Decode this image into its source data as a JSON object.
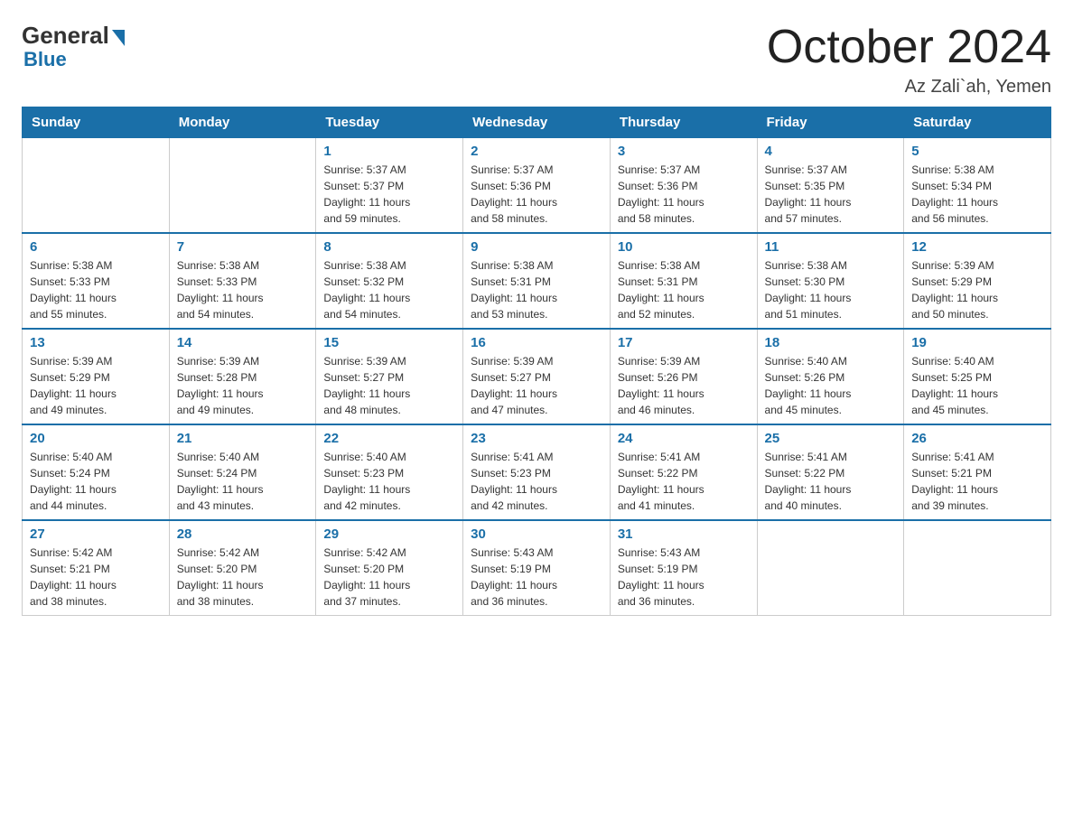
{
  "logo": {
    "general": "General",
    "blue": "Blue",
    "tagline": "Blue"
  },
  "title": "October 2024",
  "location": "Az Zali`ah, Yemen",
  "days_of_week": [
    "Sunday",
    "Monday",
    "Tuesday",
    "Wednesday",
    "Thursday",
    "Friday",
    "Saturday"
  ],
  "weeks": [
    [
      {
        "day": "",
        "info": ""
      },
      {
        "day": "",
        "info": ""
      },
      {
        "day": "1",
        "info": "Sunrise: 5:37 AM\nSunset: 5:37 PM\nDaylight: 11 hours\nand 59 minutes."
      },
      {
        "day": "2",
        "info": "Sunrise: 5:37 AM\nSunset: 5:36 PM\nDaylight: 11 hours\nand 58 minutes."
      },
      {
        "day": "3",
        "info": "Sunrise: 5:37 AM\nSunset: 5:36 PM\nDaylight: 11 hours\nand 58 minutes."
      },
      {
        "day": "4",
        "info": "Sunrise: 5:37 AM\nSunset: 5:35 PM\nDaylight: 11 hours\nand 57 minutes."
      },
      {
        "day": "5",
        "info": "Sunrise: 5:38 AM\nSunset: 5:34 PM\nDaylight: 11 hours\nand 56 minutes."
      }
    ],
    [
      {
        "day": "6",
        "info": "Sunrise: 5:38 AM\nSunset: 5:33 PM\nDaylight: 11 hours\nand 55 minutes."
      },
      {
        "day": "7",
        "info": "Sunrise: 5:38 AM\nSunset: 5:33 PM\nDaylight: 11 hours\nand 54 minutes."
      },
      {
        "day": "8",
        "info": "Sunrise: 5:38 AM\nSunset: 5:32 PM\nDaylight: 11 hours\nand 54 minutes."
      },
      {
        "day": "9",
        "info": "Sunrise: 5:38 AM\nSunset: 5:31 PM\nDaylight: 11 hours\nand 53 minutes."
      },
      {
        "day": "10",
        "info": "Sunrise: 5:38 AM\nSunset: 5:31 PM\nDaylight: 11 hours\nand 52 minutes."
      },
      {
        "day": "11",
        "info": "Sunrise: 5:38 AM\nSunset: 5:30 PM\nDaylight: 11 hours\nand 51 minutes."
      },
      {
        "day": "12",
        "info": "Sunrise: 5:39 AM\nSunset: 5:29 PM\nDaylight: 11 hours\nand 50 minutes."
      }
    ],
    [
      {
        "day": "13",
        "info": "Sunrise: 5:39 AM\nSunset: 5:29 PM\nDaylight: 11 hours\nand 49 minutes."
      },
      {
        "day": "14",
        "info": "Sunrise: 5:39 AM\nSunset: 5:28 PM\nDaylight: 11 hours\nand 49 minutes."
      },
      {
        "day": "15",
        "info": "Sunrise: 5:39 AM\nSunset: 5:27 PM\nDaylight: 11 hours\nand 48 minutes."
      },
      {
        "day": "16",
        "info": "Sunrise: 5:39 AM\nSunset: 5:27 PM\nDaylight: 11 hours\nand 47 minutes."
      },
      {
        "day": "17",
        "info": "Sunrise: 5:39 AM\nSunset: 5:26 PM\nDaylight: 11 hours\nand 46 minutes."
      },
      {
        "day": "18",
        "info": "Sunrise: 5:40 AM\nSunset: 5:26 PM\nDaylight: 11 hours\nand 45 minutes."
      },
      {
        "day": "19",
        "info": "Sunrise: 5:40 AM\nSunset: 5:25 PM\nDaylight: 11 hours\nand 45 minutes."
      }
    ],
    [
      {
        "day": "20",
        "info": "Sunrise: 5:40 AM\nSunset: 5:24 PM\nDaylight: 11 hours\nand 44 minutes."
      },
      {
        "day": "21",
        "info": "Sunrise: 5:40 AM\nSunset: 5:24 PM\nDaylight: 11 hours\nand 43 minutes."
      },
      {
        "day": "22",
        "info": "Sunrise: 5:40 AM\nSunset: 5:23 PM\nDaylight: 11 hours\nand 42 minutes."
      },
      {
        "day": "23",
        "info": "Sunrise: 5:41 AM\nSunset: 5:23 PM\nDaylight: 11 hours\nand 42 minutes."
      },
      {
        "day": "24",
        "info": "Sunrise: 5:41 AM\nSunset: 5:22 PM\nDaylight: 11 hours\nand 41 minutes."
      },
      {
        "day": "25",
        "info": "Sunrise: 5:41 AM\nSunset: 5:22 PM\nDaylight: 11 hours\nand 40 minutes."
      },
      {
        "day": "26",
        "info": "Sunrise: 5:41 AM\nSunset: 5:21 PM\nDaylight: 11 hours\nand 39 minutes."
      }
    ],
    [
      {
        "day": "27",
        "info": "Sunrise: 5:42 AM\nSunset: 5:21 PM\nDaylight: 11 hours\nand 38 minutes."
      },
      {
        "day": "28",
        "info": "Sunrise: 5:42 AM\nSunset: 5:20 PM\nDaylight: 11 hours\nand 38 minutes."
      },
      {
        "day": "29",
        "info": "Sunrise: 5:42 AM\nSunset: 5:20 PM\nDaylight: 11 hours\nand 37 minutes."
      },
      {
        "day": "30",
        "info": "Sunrise: 5:43 AM\nSunset: 5:19 PM\nDaylight: 11 hours\nand 36 minutes."
      },
      {
        "day": "31",
        "info": "Sunrise: 5:43 AM\nSunset: 5:19 PM\nDaylight: 11 hours\nand 36 minutes."
      },
      {
        "day": "",
        "info": ""
      },
      {
        "day": "",
        "info": ""
      }
    ]
  ]
}
